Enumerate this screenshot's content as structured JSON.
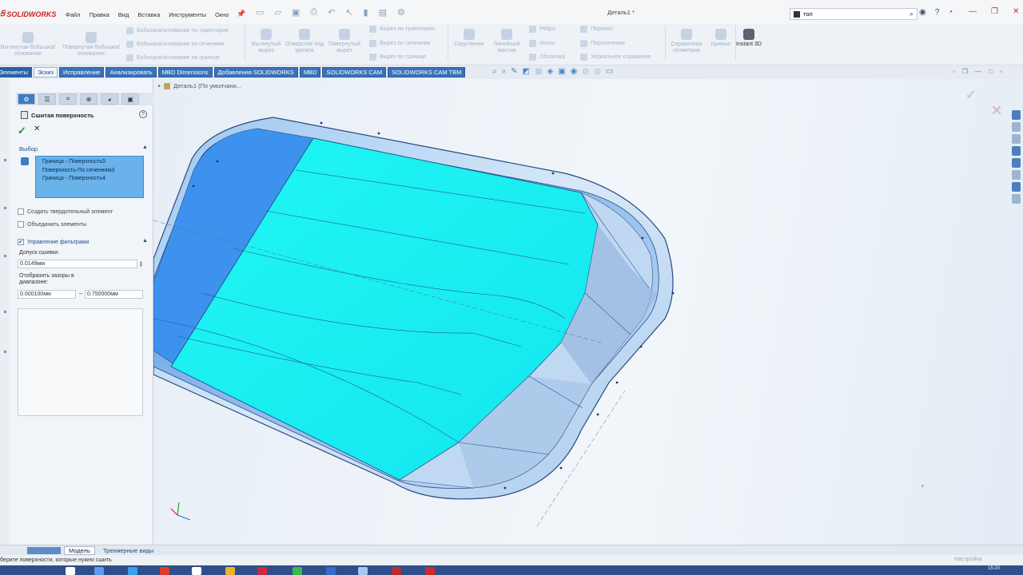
{
  "app": {
    "logo": "SOLIDWORKS",
    "document_title": "Деталь1 *"
  },
  "menu": [
    "Файл",
    "Правка",
    "Вид",
    "Вставка",
    "Инструменты",
    "Окно"
  ],
  "search": {
    "value": "тол"
  },
  "ribbon": {
    "boss_extrude": "Вытянутая бобышка/основание",
    "boss_revolve": "Повернутая бобышка/основание",
    "boss_sweep": "Бобышка/основание по траектории",
    "boss_loft": "Бобышка/основание по сечениям",
    "boss_boundary": "Бобышка/основание на границе",
    "cut_extrude": "Вытянутый вырез",
    "hole_wizard": "Отверстие под крепеж",
    "cut_revolve": "Повернутый вырез",
    "cut_sweep": "Вырез по траектории",
    "cut_loft": "Вырез по сечениям",
    "cut_boundary": "Вырез по границе",
    "fillet": "Скругление",
    "linear_pattern": "Линейный массив",
    "rib": "Ребро",
    "draft": "Уклон",
    "shell": "Оболочка",
    "wrap": "Перенос",
    "intersect": "Пересечение",
    "mirror": "Зеркальное отражение",
    "ref_geometry": "Справочная геометрия",
    "curves": "Кривые",
    "instant3d": "Instant 3D"
  },
  "tabs": [
    {
      "label": "Элементы",
      "active": false
    },
    {
      "label": "Эскиз",
      "active": false
    },
    {
      "label": "Исправление",
      "active": false
    },
    {
      "label": "Анализировать",
      "active": false
    },
    {
      "label": "MBD Dimensions",
      "active": false
    },
    {
      "label": "Добавления SOLIDWORKS",
      "active": false
    },
    {
      "label": "MBD",
      "active": false
    },
    {
      "label": "SOLIDWORKS CAM",
      "active": false
    },
    {
      "label": "SOLIDWORKS CAM TBM",
      "active": false
    }
  ],
  "property_manager": {
    "title": "Сшитая поверхность",
    "selection_group": "Выбор",
    "selected_items": [
      "Граница - Поверхность5",
      "Поверхность-По сечениям3",
      "Граница - Поверхность4"
    ],
    "create_solid": "Создать твердотельный элемент",
    "merge_entities": "Объединить элементы",
    "gap_control_group": "Управление фильтрами",
    "knit_tolerance_label": "Допуск сшивки:",
    "knit_tolerance_value": "0.0149мм",
    "show_gaps_label": "Отобразить зазоры в диапазоне:",
    "gap_min": "0.000100мм",
    "gap_max": "0.750000мм"
  },
  "viewport": {
    "breadcrumb": "Деталь1  (По умолчани..."
  },
  "bottom_tabs": [
    "Модель",
    "Трехмерные виды"
  ],
  "status": {
    "message": "берите поверхности, которые нужно сшить",
    "right": "Настройка",
    "clock": "15:20"
  },
  "colors": {
    "surface_cyan": "#19f0ee",
    "surface_blue": "#3d92ee",
    "tab_blue": "#3a72b8",
    "selection_list": "#69b2ea"
  }
}
